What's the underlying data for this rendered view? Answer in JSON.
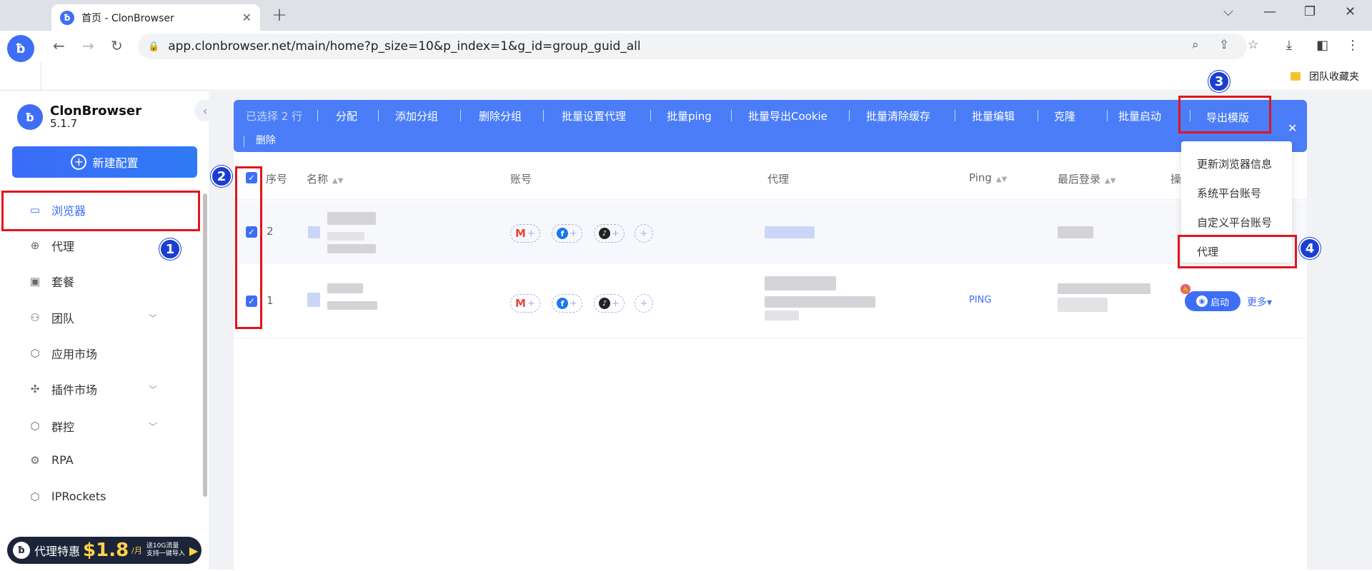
{
  "browser": {
    "tab_title": "首页 - ClonBrowser",
    "tab_favicon": "ClonBrowser",
    "url": "app.clonbrowser.net/main/home?p_size=10&p_index=1&g_id=group_guid_all",
    "bookmark_folder": "团队收藏夹"
  },
  "sidebar": {
    "brand_name": "ClonBrowser",
    "version": "5.1.7",
    "new_config_label": "新建配置",
    "items": [
      {
        "label": "浏览器",
        "icon": "browser-icon"
      },
      {
        "label": "代理",
        "icon": "globe-icon"
      },
      {
        "label": "套餐",
        "icon": "wallet-icon"
      },
      {
        "label": "团队",
        "icon": "team-icon"
      },
      {
        "label": "应用市场",
        "icon": "cube-icon"
      },
      {
        "label": "插件市场",
        "icon": "puzzle-icon"
      },
      {
        "label": "群控",
        "icon": "cube-icon"
      },
      {
        "label": "RPA",
        "icon": "robot-icon"
      },
      {
        "label": "IPRockets",
        "icon": "cube-icon"
      }
    ],
    "promo": {
      "label": "代理特惠",
      "price": "$1.8",
      "unit": "/月",
      "line1": "送10G流量",
      "line2": "支持一键导入"
    }
  },
  "actionbar": {
    "selected_label": "已选择 2 行",
    "actions": [
      "分配",
      "添加分组",
      "删除分组",
      "批量设置代理",
      "批量ping",
      "批量导出Cookie",
      "批量清除缓存",
      "批量编辑",
      "克隆",
      "批量启动",
      "导出模版"
    ],
    "delete_label": "删除"
  },
  "table": {
    "headers": {
      "index": "序号",
      "name": "名称",
      "account": "账号",
      "proxy": "代理",
      "ping": "Ping",
      "last_login": "最后登录",
      "action": "操"
    },
    "rows": [
      {
        "index": "2",
        "ping": "",
        "start_label": "",
        "more_label": ""
      },
      {
        "index": "1",
        "ping": "PING",
        "start_label": "启动",
        "more_label": "更多▾"
      }
    ]
  },
  "export_dropdown": {
    "items": [
      "更新浏览器信息",
      "系统平台账号",
      "自定义平台账号",
      "代理"
    ]
  },
  "annotations": [
    "1",
    "2",
    "3",
    "4"
  ],
  "colors": {
    "accent": "#3d6ef5",
    "actionbar": "#4a7df7",
    "annotation_red": "#e3141b",
    "annotation_badge": "#1a3fd0"
  }
}
